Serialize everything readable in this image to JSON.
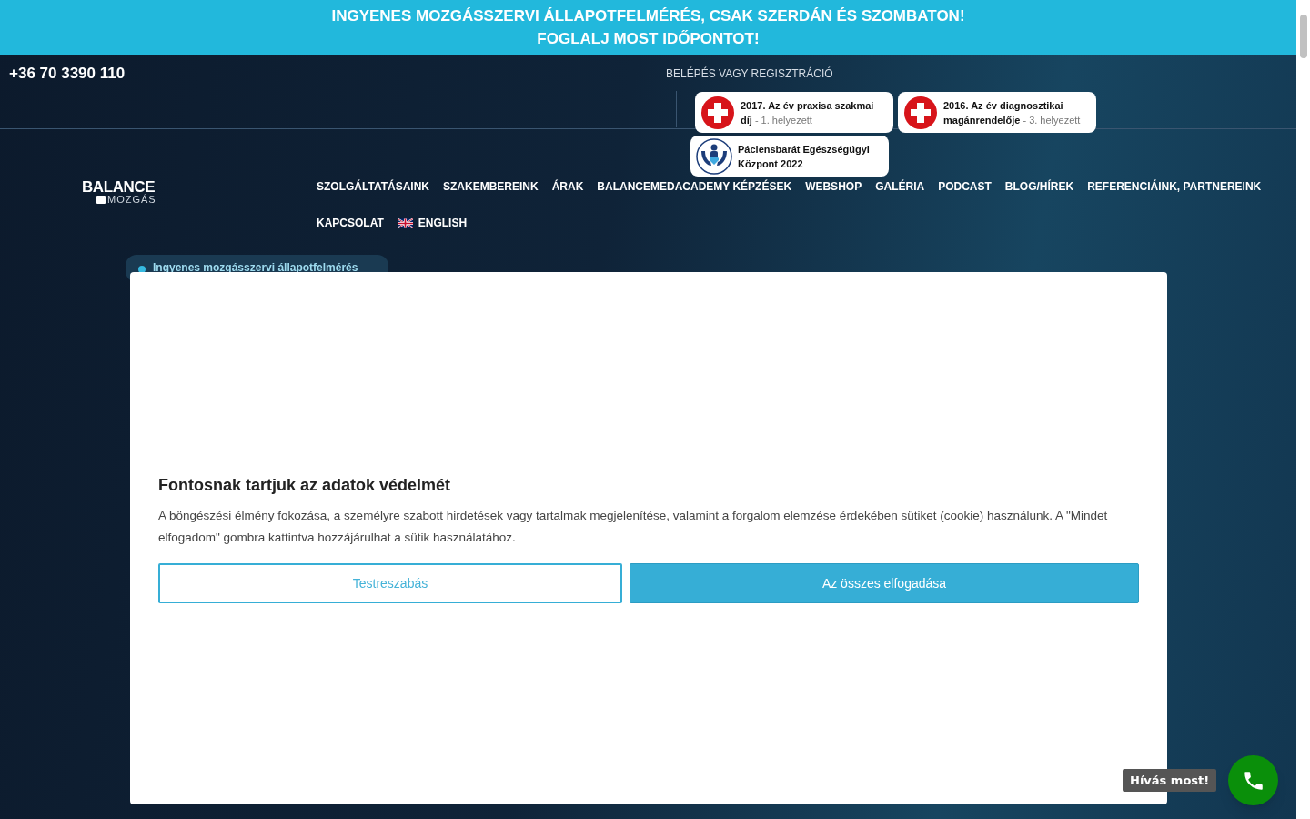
{
  "promo_banner": {
    "lines": [
      "INGYENES MOZGÁSSZERVI ÁLLAPOTFELMÉRÉS, CSAK SZERDÁN ÉS SZOMBATON!",
      "FOGLALJ MOST IDŐPONTOT!"
    ]
  },
  "header": {
    "phone": "+36 70 3390 110",
    "login_link": "BELÉPÉS VAGY REGISZTRÁCIÓ",
    "badges": [
      {
        "kind": "cross",
        "title": "2017. Az év praxisa szakmai díj",
        "note": " - 1. helyezett"
      },
      {
        "kind": "cross",
        "title": "2016. Az év diagnosztikai magánrendelője",
        "note": " - 3. helyezett"
      },
      {
        "kind": "caring",
        "title": "Páciensbarát Egészségügyi Központ 2022"
      }
    ],
    "logo": {
      "line1": "BALANCE",
      "line2": "MOZGÁS"
    },
    "nav": [
      {
        "label": "SZOLGÁLTATÁSAINK"
      },
      {
        "label": "SZAKEMBEREINK"
      },
      {
        "label": "ÁRAK"
      },
      {
        "label": "BALANCEMEDACADEMY KÉPZÉSEK"
      },
      {
        "label": "WEBSHOP"
      },
      {
        "label": "GALÉRIA"
      },
      {
        "label": "PODCAST"
      },
      {
        "label": "BLOG/HÍREK"
      },
      {
        "label": "REFERENCIÁINK, PARTNEREINK"
      },
      {
        "label": "KAPCSOLAT"
      },
      {
        "label": "ENGLISH",
        "kind": "flag"
      }
    ]
  },
  "hero_tag": "Ingyenes mozgásszervi állapotfelmérés",
  "cookie_dialog": {
    "title": "Fontosnak tartjuk az adatok védelmét",
    "text": "A böngészési élmény fokozása, a személyre szabott hirdetések vagy tartalmak megjelenítése, valamint a forgalom elemzése érdekében sütiket (cookie) használunk. A \"Mindet elfogadom\" gombra kattintva hozzájárulhat a sütik használatához.",
    "buttons": [
      {
        "label": "Testreszabás",
        "kind": "outline"
      },
      {
        "label": "Az összes elfogadása",
        "kind": "filled"
      }
    ]
  },
  "call_widget": {
    "tooltip": "Hívás most!"
  }
}
